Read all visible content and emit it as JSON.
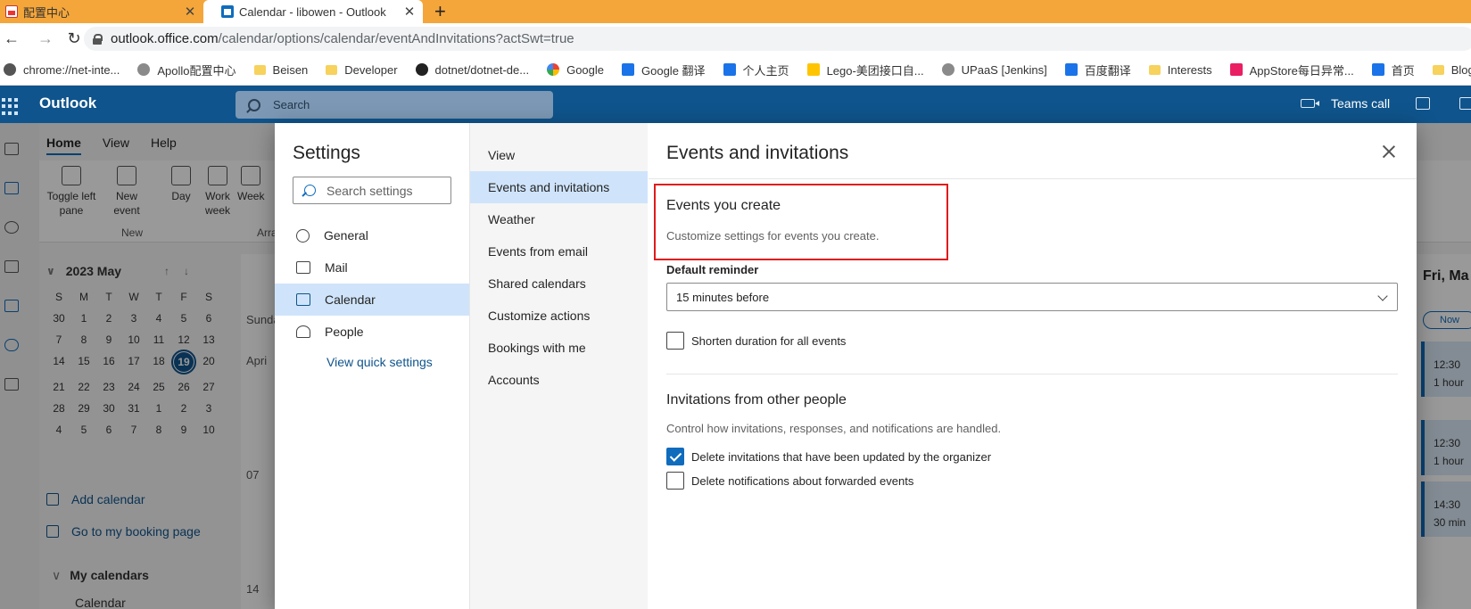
{
  "browser": {
    "tabs": [
      {
        "label": "配置中心",
        "active": false
      },
      {
        "label": "Calendar - libowen - Outlook",
        "active": true
      }
    ],
    "url_host": "outlook.office.com",
    "url_path": "/calendar/options/calendar/eventAndInvitations?actSwt=true",
    "bookmarks": [
      {
        "label": "chrome://net-inte...",
        "icon": "globe-icon"
      },
      {
        "label": "Apollo配置中心",
        "icon": "apollo-icon"
      },
      {
        "label": "Beisen",
        "icon": "folder-icon"
      },
      {
        "label": "Developer",
        "icon": "folder-icon"
      },
      {
        "label": "dotnet/dotnet-de...",
        "icon": "github-icon"
      },
      {
        "label": "Google",
        "icon": "google-icon"
      },
      {
        "label": "Google 翻译",
        "icon": "translate-icon"
      },
      {
        "label": "个人主页",
        "icon": "info-icon"
      },
      {
        "label": "Lego-美团接口自...",
        "icon": "meituan-icon"
      },
      {
        "label": "UPaaS [Jenkins]",
        "icon": "jenkins-icon"
      },
      {
        "label": "百度翻译",
        "icon": "baidu-translate-icon"
      },
      {
        "label": "Interests",
        "icon": "folder-icon"
      },
      {
        "label": "AppStore每日异常...",
        "icon": "appstore-icon"
      },
      {
        "label": "首页",
        "icon": "info-icon"
      },
      {
        "label": "Blog",
        "icon": "folder-icon"
      }
    ]
  },
  "header": {
    "brand": "Outlook",
    "search_placeholder": "Search",
    "teams_call": "Teams call"
  },
  "background": {
    "ribbon_tabs": [
      "Home",
      "View",
      "Help"
    ],
    "ribbon_buttons": {
      "toggle_pane": "Toggle left pane",
      "new_event": "New event",
      "day": "Day",
      "work_week": "Work week",
      "week": "Week"
    },
    "group_new": "New",
    "group_arrange": "Arra",
    "minical": {
      "title": "2023 May",
      "weekdays": [
        "S",
        "M",
        "T",
        "W",
        "T",
        "F",
        "S"
      ],
      "days": [
        "30",
        "1",
        "2",
        "3",
        "4",
        "5",
        "6",
        "7",
        "8",
        "9",
        "10",
        "11",
        "12",
        "13",
        "14",
        "15",
        "16",
        "17",
        "18",
        "19",
        "20",
        "21",
        "22",
        "23",
        "24",
        "25",
        "26",
        "27",
        "28",
        "29",
        "30",
        "31",
        "1",
        "2",
        "3",
        "4",
        "5",
        "6",
        "7",
        "8",
        "9",
        "10"
      ],
      "today": "19"
    },
    "add_calendar": "Add calendar",
    "booking_page": "Go to my booking page",
    "my_calendars": "My calendars",
    "calendar_item": "Calendar",
    "sunday": "Sunda",
    "april": "Apri",
    "row07": "07",
    "row14": "14",
    "fri": "Fri, Ma",
    "now": "Now",
    "events": [
      {
        "time": "12:30",
        "dur": "1 hour"
      },
      {
        "time": "12:30",
        "dur": "1 hour"
      },
      {
        "time": "14:30",
        "dur": "30 min"
      }
    ]
  },
  "settings": {
    "title": "Settings",
    "search_placeholder": "Search settings",
    "categories": [
      {
        "label": "General",
        "icon": "gear-icon"
      },
      {
        "label": "Mail",
        "icon": "mail-icon"
      },
      {
        "label": "Calendar",
        "icon": "calendar-icon",
        "selected": true
      },
      {
        "label": "People",
        "icon": "people-icon"
      }
    ],
    "quick_settings": "View quick settings",
    "subcategories": [
      {
        "label": "View"
      },
      {
        "label": "Events and invitations",
        "selected": true
      },
      {
        "label": "Weather"
      },
      {
        "label": "Events from email"
      },
      {
        "label": "Shared calendars"
      },
      {
        "label": "Customize actions"
      },
      {
        "label": "Bookings with me"
      },
      {
        "label": "Accounts"
      }
    ]
  },
  "content": {
    "title": "Events and invitations",
    "events_you_create": {
      "heading": "Events you create",
      "description": "Customize settings for events you create."
    },
    "default_reminder_label": "Default reminder",
    "default_reminder_value": "15 minutes before",
    "shorten_duration": {
      "label": "Shorten duration for all events",
      "checked": false
    },
    "invitations": {
      "heading": "Invitations from other people",
      "description": "Control how invitations, responses, and notifications are handled.",
      "options": [
        {
          "label": "Delete invitations that have been updated by the organizer",
          "checked": true
        },
        {
          "label": "Delete notifications about forwarded events",
          "checked": false
        }
      ]
    }
  },
  "colors": {
    "tabbar": "#f4a63a",
    "header": "#0f548c",
    "accent": "#0f6cbd",
    "selection": "#cfe4fa",
    "highlight_box": "#e01b1b"
  }
}
